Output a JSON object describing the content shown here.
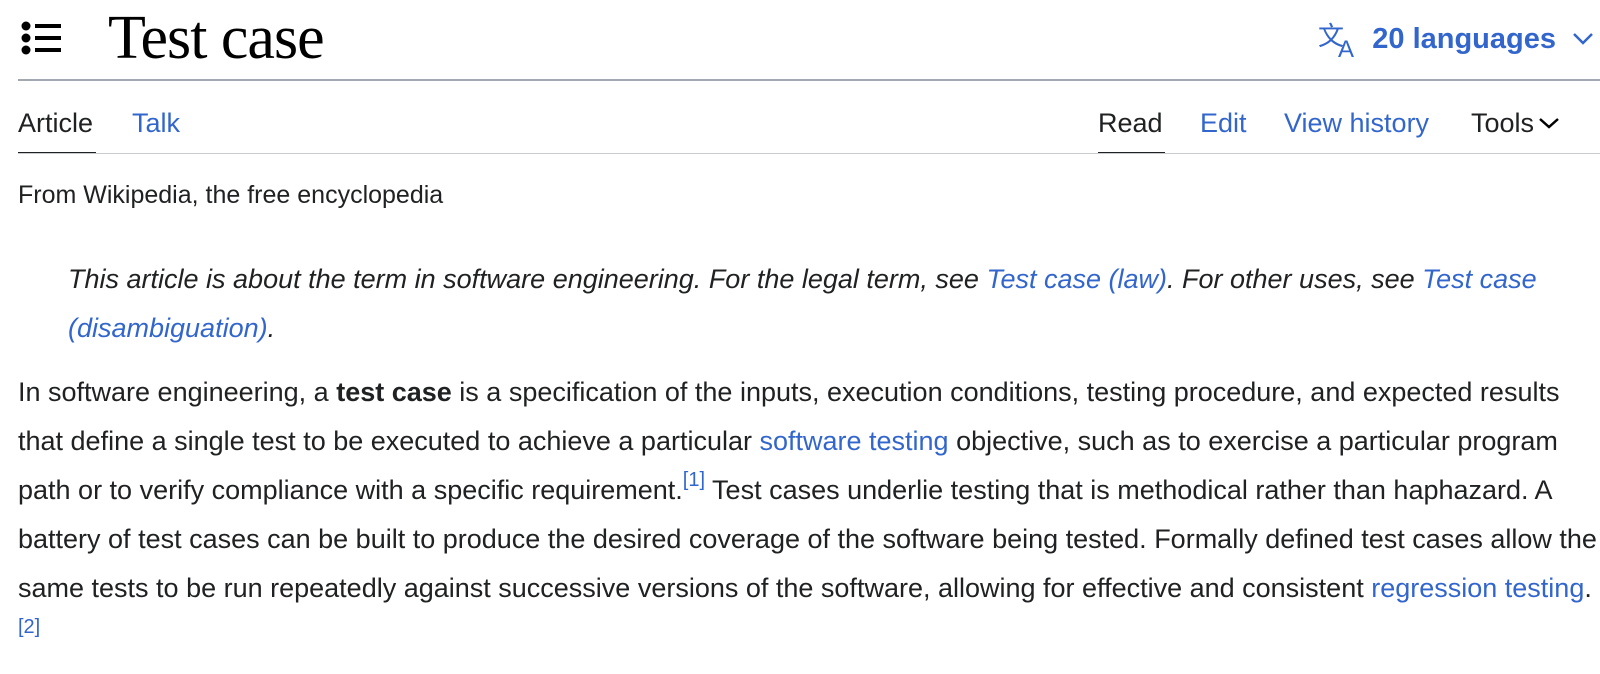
{
  "header": {
    "title": "Test case",
    "toc_icon": "list-bullet-icon",
    "languages": {
      "icon": "language-icon",
      "label": "20 languages",
      "chevron": "chevron-down-icon"
    }
  },
  "tabs": {
    "left": [
      {
        "label": "Article",
        "selected": true
      },
      {
        "label": "Talk",
        "selected": false
      }
    ],
    "right": [
      {
        "label": "Read",
        "selected": true
      },
      {
        "label": "Edit",
        "selected": false
      },
      {
        "label": "View history",
        "selected": false
      },
      {
        "label": "Tools",
        "selected": false,
        "icon": "chevron-down-icon"
      }
    ]
  },
  "tagline": "From Wikipedia, the free encyclopedia",
  "hatnote": {
    "part1": "This article is about the term in software engineering. For the legal term, see ",
    "link1": "Test case (law)",
    "part2": ". For other uses, see ",
    "link2": "Test case (disambiguation)",
    "part3": "."
  },
  "paragraph": {
    "t1": "In software engineering, a ",
    "bold": "test case",
    "t2": " is a specification of the inputs, execution conditions, testing procedure, and expected results that define a single test to be executed to achieve a particular ",
    "link1": "software testing",
    "t3": " objective, such as to exercise a particular program path or to verify compliance with a specific requirement.",
    "ref1": "[1]",
    "t4": " Test cases underlie testing that is methodical rather than haphazard. A battery of test cases can be built to produce the desired coverage of the software being tested. Formally defined test cases allow the same tests to be run repeatedly against successive versions of the software, allowing for effective and consistent ",
    "link2": "regression testing",
    "t5": ".",
    "ref2": "[2]"
  },
  "colors": {
    "link": "#3366cc",
    "text": "#202122",
    "divider": "#a2a9b1"
  }
}
